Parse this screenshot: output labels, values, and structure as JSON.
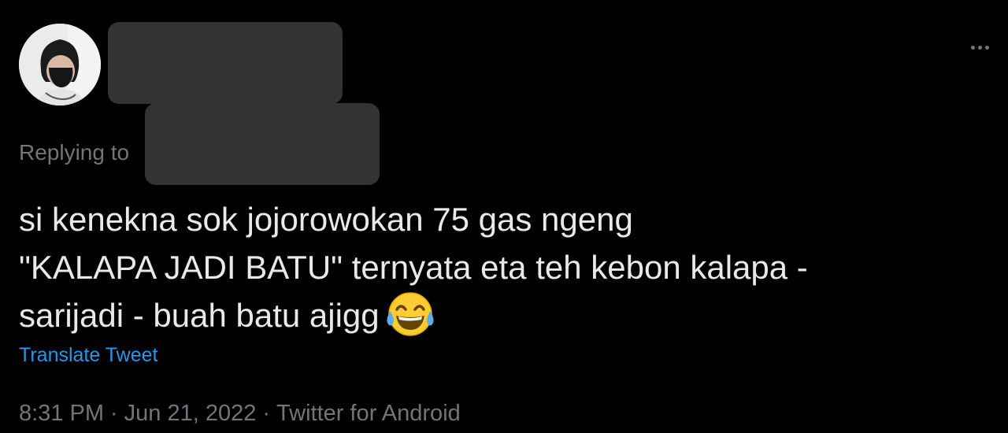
{
  "reply": {
    "replying_to_label": "Replying to"
  },
  "tweet": {
    "lines": [
      "si kenekna sok jojorowokan 75 gas ngeng",
      "\"KALAPA JADI BATU\" ternyata eta teh kebon kalapa -",
      "sarijadi - buah batu ajigg"
    ],
    "emoji": "face-with-tears-of-joy"
  },
  "actions": {
    "translate_label": "Translate Tweet"
  },
  "meta": {
    "time": "8:31 PM",
    "separator": "·",
    "date": "Jun 21, 2022",
    "source": "Twitter for Android"
  },
  "colors": {
    "background": "#000000",
    "text": "#e7e9ea",
    "secondary": "#71767b",
    "link": "#1d9bf0",
    "redaction": "#333333"
  }
}
